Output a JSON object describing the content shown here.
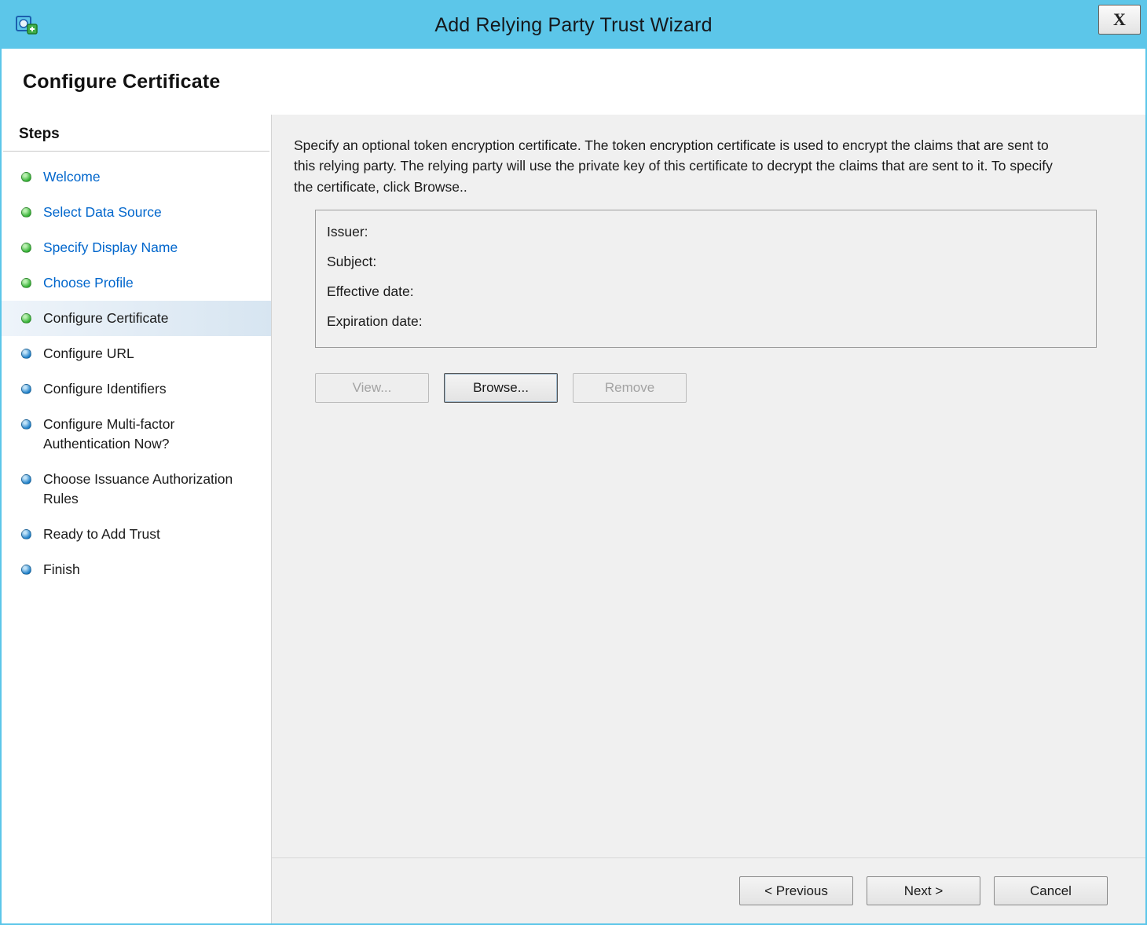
{
  "window": {
    "title": "Add Relying Party Trust Wizard",
    "close_label": "X"
  },
  "header": {
    "title": "Configure Certificate"
  },
  "sidebar": {
    "heading": "Steps",
    "items": [
      {
        "label": "Welcome",
        "state": "completed-link"
      },
      {
        "label": "Select Data Source",
        "state": "completed-link"
      },
      {
        "label": "Specify Display Name",
        "state": "completed-link"
      },
      {
        "label": "Choose Profile",
        "state": "completed-link"
      },
      {
        "label": "Configure Certificate",
        "state": "current"
      },
      {
        "label": "Configure URL",
        "state": "upcoming"
      },
      {
        "label": "Configure Identifiers",
        "state": "upcoming"
      },
      {
        "label": "Configure Multi-factor Authentication Now?",
        "state": "upcoming"
      },
      {
        "label": "Choose Issuance Authorization Rules",
        "state": "upcoming"
      },
      {
        "label": "Ready to Add Trust",
        "state": "upcoming"
      },
      {
        "label": "Finish",
        "state": "upcoming"
      }
    ]
  },
  "content": {
    "description": "Specify an optional token encryption certificate.  The token encryption certificate is used to encrypt the claims that are sent to this relying party.  The relying party will use the private key of this certificate to decrypt the claims that are sent to it.  To specify the certificate, click Browse..",
    "certificate_fields": [
      {
        "label": "Issuer:",
        "value": ""
      },
      {
        "label": "Subject:",
        "value": ""
      },
      {
        "label": "Effective date:",
        "value": ""
      },
      {
        "label": "Expiration date:",
        "value": ""
      }
    ],
    "buttons": {
      "view": "View...",
      "browse": "Browse...",
      "remove": "Remove"
    }
  },
  "footer": {
    "previous": "< Previous",
    "next": "Next >",
    "cancel": "Cancel"
  },
  "colors": {
    "titlebar": "#5cc6e9",
    "link": "#0066cc",
    "completed_dot": "#35b135",
    "upcoming_dot": "#1e7fc8",
    "current_step_bg": "#dde9f3"
  }
}
